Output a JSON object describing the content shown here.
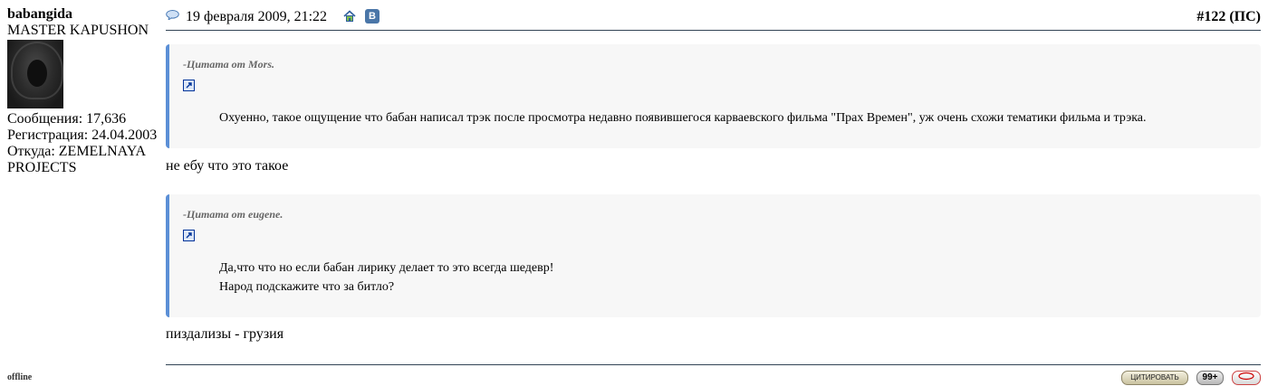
{
  "user": {
    "username": "babangida",
    "title": "MASTER KAPUSHON",
    "posts_label": "Сообщения: 17,636",
    "registration_label": "Регистрация: 24.04.2003",
    "location_line1": "Откуда: ZEMELNAYA",
    "location_line2": "PROJECTS",
    "status": "offline"
  },
  "post": {
    "date": "19 февраля 2009, 21:22",
    "number": "#122 (ПС)",
    "quotes": [
      {
        "author": "-Цитата от Mors.",
        "lines": [
          "Охуенно, такое ощущение что бабан написал трэк после просмотра недавно появившегося карваевского фильма \"Прах Времен\", уж очень схожи тематики фильма и трэка."
        ]
      },
      {
        "author": "-Цитата от eugene.",
        "lines": [
          "Да,что что но если бабан лирику делает то это всегда шедевр!",
          "Народ подскажите что за битло?"
        ]
      }
    ],
    "replies": [
      "не ебу что это такое",
      "пиздализы - грузия"
    ]
  },
  "buttons": {
    "quote": "ЦИТИРОВАТЬ",
    "multiquote": "99+",
    "vk": "B"
  },
  "colors": {
    "quote_border": "#5b8fd6",
    "quote_bg": "#f7f7f7",
    "separator": "#334455"
  }
}
